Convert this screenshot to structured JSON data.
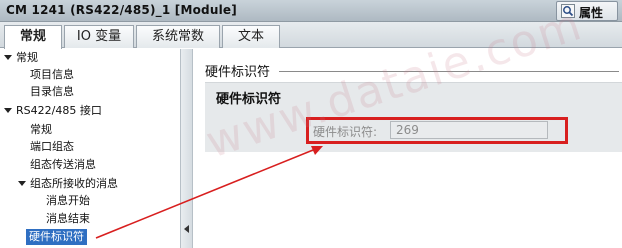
{
  "window": {
    "title": "CM 1241 (RS422/485)_1 [Module]"
  },
  "properties_button": {
    "label": "属性",
    "icon": "properties-icon"
  },
  "tabs": [
    {
      "label": "常规",
      "active": true
    },
    {
      "label": "IO 变量",
      "active": false
    },
    {
      "label": "系统常数",
      "active": false
    },
    {
      "label": "文本",
      "active": false
    }
  ],
  "tree": {
    "items": [
      {
        "label": "常规",
        "level": 0,
        "expanded": true
      },
      {
        "label": "项目信息",
        "level": 1
      },
      {
        "label": "目录信息",
        "level": 1
      },
      {
        "label": "RS422/485 接口",
        "level": 0,
        "expanded": true
      },
      {
        "label": "常规",
        "level": 1
      },
      {
        "label": "端口组态",
        "level": 1
      },
      {
        "label": "组态传送消息",
        "level": 1
      },
      {
        "label": "组态所接收的消息",
        "level": 1,
        "expanded": true
      },
      {
        "label": "消息开始",
        "level": 2
      },
      {
        "label": "消息结束",
        "level": 2
      },
      {
        "label": "硬件标识符",
        "level": 0,
        "selected": true
      }
    ]
  },
  "content": {
    "section_title": "硬件标识符",
    "panel_title": "硬件标识符",
    "field_label": "硬件标识符:",
    "field_value": "269"
  },
  "watermark": "www.dataie.com",
  "colors": {
    "highlight": "#d81f1f",
    "selection": "#2f6fc2"
  }
}
